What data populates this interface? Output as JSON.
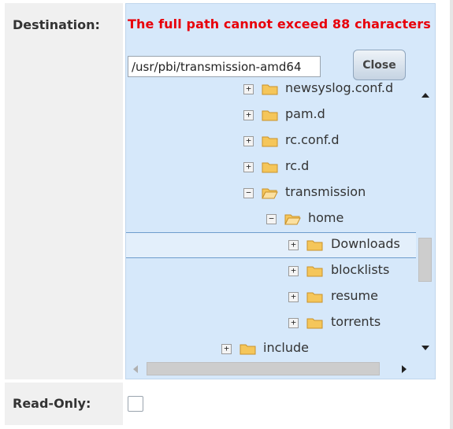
{
  "destination": {
    "label": "Destination:",
    "error_message": "The full path cannot exceed 88 characters",
    "path_value": "/usr/pbi/transmission-amd64",
    "close_label": "Close",
    "tree_items": [
      {
        "label": "newsyslog.conf.d",
        "toggle": "+",
        "expanded": false,
        "selected": false
      },
      {
        "label": "pam.d",
        "toggle": "+",
        "expanded": false,
        "selected": false
      },
      {
        "label": "rc.conf.d",
        "toggle": "+",
        "expanded": false,
        "selected": false
      },
      {
        "label": "rc.d",
        "toggle": "+",
        "expanded": false,
        "selected": false
      },
      {
        "label": "transmission",
        "toggle": "−",
        "expanded": true,
        "selected": false
      },
      {
        "label": "home",
        "toggle": "−",
        "expanded": true,
        "selected": false
      },
      {
        "label": "Downloads",
        "toggle": "+",
        "expanded": false,
        "selected": true
      },
      {
        "label": "blocklists",
        "toggle": "+",
        "expanded": false,
        "selected": false
      },
      {
        "label": "resume",
        "toggle": "+",
        "expanded": false,
        "selected": false
      },
      {
        "label": "torrents",
        "toggle": "+",
        "expanded": false,
        "selected": false
      },
      {
        "label": "include",
        "toggle": "+",
        "expanded": false,
        "selected": false
      }
    ]
  },
  "read_only": {
    "label": "Read-Only:",
    "checked": false
  },
  "colors": {
    "error": "#e8000a",
    "panel_bg": "#d6e8fa",
    "selected_border": "#6e9ccc",
    "folder": "#f5c65a"
  },
  "icons": {
    "folder": "folder-icon",
    "folder_open": "folder-open-icon",
    "expand": "expand-icon",
    "collapse": "collapse-icon"
  }
}
